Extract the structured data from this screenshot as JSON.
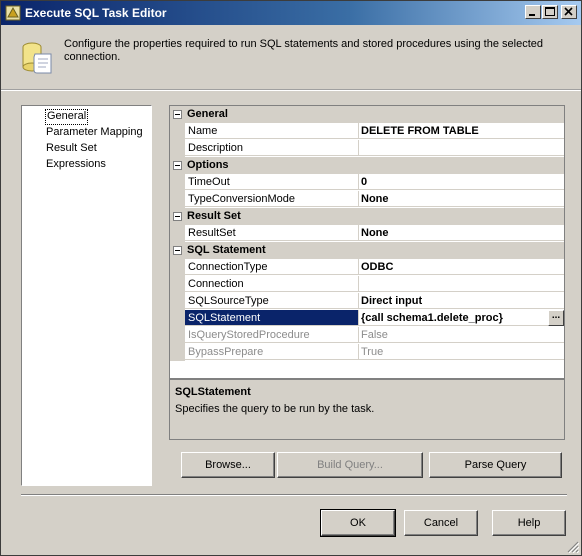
{
  "window": {
    "title": "Execute SQL Task Editor",
    "icon": "sql-task-icon"
  },
  "header": {
    "description": "Configure the properties required to run SQL statements and stored procedures using the selected connection.",
    "icon": "database-scroll-icon"
  },
  "nav": {
    "items": [
      {
        "label": "General",
        "selected": true
      },
      {
        "label": "Parameter Mapping",
        "selected": false
      },
      {
        "label": "Result Set",
        "selected": false
      },
      {
        "label": "Expressions",
        "selected": false
      }
    ]
  },
  "grid": {
    "categories": [
      {
        "label": "General",
        "rows": [
          {
            "name": "Name",
            "value": "DELETE FROM TABLE"
          },
          {
            "name": "Description",
            "value": ""
          }
        ]
      },
      {
        "label": "Options",
        "rows": [
          {
            "name": "TimeOut",
            "value": "0"
          },
          {
            "name": "TypeConversionMode",
            "value": "None"
          }
        ]
      },
      {
        "label": "Result Set",
        "rows": [
          {
            "name": "ResultSet",
            "value": "None"
          }
        ]
      },
      {
        "label": "SQL Statement",
        "rows": [
          {
            "name": "ConnectionType",
            "value": "ODBC"
          },
          {
            "name": "Connection",
            "value": ""
          },
          {
            "name": "SQLSourceType",
            "value": "Direct input"
          },
          {
            "name": "SQLStatement",
            "value": "{call schema1.delete_proc}",
            "selected": true,
            "ellipsis": "..."
          },
          {
            "name": "IsQueryStoredProcedure",
            "value": "False",
            "disabled": true
          },
          {
            "name": "BypassPrepare",
            "value": "True",
            "disabled": true
          }
        ]
      }
    ]
  },
  "help": {
    "title": "SQLStatement",
    "text": "Specifies the query to be run by the task."
  },
  "actions": {
    "browse": "Browse...",
    "build_query": "Build Query...",
    "parse_query": "Parse Query"
  },
  "footer": {
    "ok": "OK",
    "cancel": "Cancel",
    "help": "Help"
  },
  "colors": {
    "titlebar_start": "#0a246a",
    "titlebar_end": "#a6caf0",
    "selection": "#0a246a",
    "face": "#d4d0c8"
  }
}
